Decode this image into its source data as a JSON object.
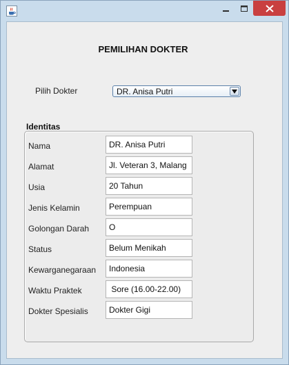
{
  "form": {
    "title": "PEMILIHAN DOKTER",
    "pilih_label": "Pilih Dokter",
    "selected_doctor": "DR. Anisa Putri",
    "section_label": "Identitas"
  },
  "identity_rows": [
    {
      "label": "Nama",
      "value": "DR. Anisa Putri"
    },
    {
      "label": "Alamat",
      "value": "Jl. Veteran 3, Malang"
    },
    {
      "label": "Usia",
      "value": "20 Tahun"
    },
    {
      "label": "Jenis Kelamin",
      "value": "Perempuan"
    },
    {
      "label": "Golongan Darah",
      "value": "O"
    },
    {
      "label": "Status",
      "value": "Belum Menikah"
    },
    {
      "label": "Kewarganegaraan",
      "value": "Indonesia"
    },
    {
      "label": "Waktu Praktek",
      "value": " Sore (16.00-22.00)"
    },
    {
      "label": "Dokter Spesialis",
      "value": "Dokter Gigi"
    }
  ],
  "icons": {
    "app": "java-coffee-cup-icon",
    "minimize": "minimize-icon",
    "maximize": "maximize-icon",
    "close": "close-icon",
    "dropdown": "dropdown-arrow-icon"
  },
  "colors": {
    "frame": "#c9dcec",
    "close_button": "#c94040",
    "client_background": "#eeeeee",
    "field_background": "#ffffff"
  }
}
